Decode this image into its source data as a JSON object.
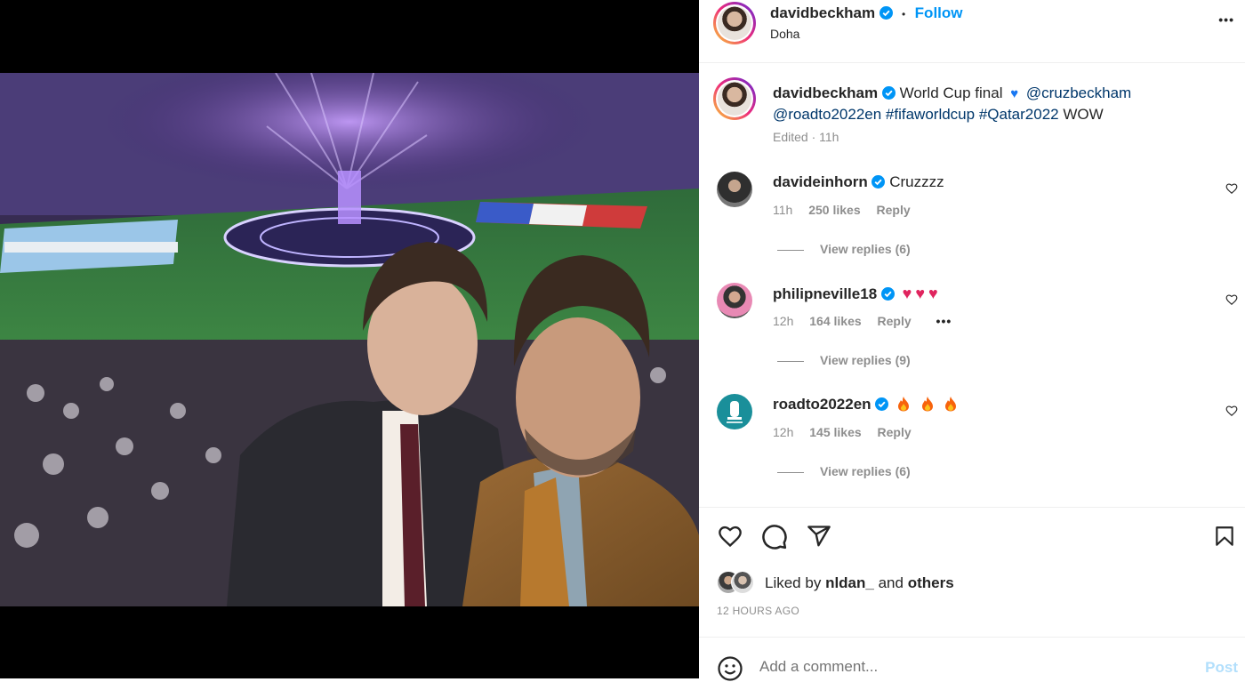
{
  "post": {
    "username": "davidbeckham",
    "follow_label": "Follow",
    "separator": "•",
    "location": "Doha",
    "more_label": "•••",
    "caption_text": "World Cup final",
    "caption_mentions": [
      "@cruzbeckham",
      "@roadto2022en",
      "#fifaworldcup",
      "#Qatar2022"
    ],
    "caption_end": "WOW",
    "caption_meta": "Edited · 11h"
  },
  "comments": [
    {
      "username": "davideinhorn",
      "text": "Cruzzzz",
      "time": "11h",
      "likes": "250 likes",
      "reply": "Reply",
      "view_replies": "View replies (6)"
    },
    {
      "username": "philipneville18",
      "text": "",
      "time": "12h",
      "likes": "164 likes",
      "reply": "Reply",
      "more": "•••",
      "view_replies": "View replies (9)"
    },
    {
      "username": "roadto2022en",
      "text": "",
      "time": "12h",
      "likes": "145 likes",
      "reply": "Reply",
      "view_replies": "View replies (6)"
    }
  ],
  "likes": {
    "prefix": "Liked by",
    "user": "nldan_",
    "and": "and",
    "others": "others"
  },
  "timestamp": "12 HOURS AGO",
  "composer": {
    "placeholder": "Add a comment...",
    "post_label": "Post"
  },
  "colors": {
    "accent": "#0095f6",
    "link": "#00376b",
    "muted": "#8e8e8e",
    "verified": "#0095f6"
  },
  "icons": [
    "heart-icon",
    "comment-icon",
    "share-icon",
    "bookmark-icon",
    "emoji-icon",
    "verified-icon"
  ]
}
